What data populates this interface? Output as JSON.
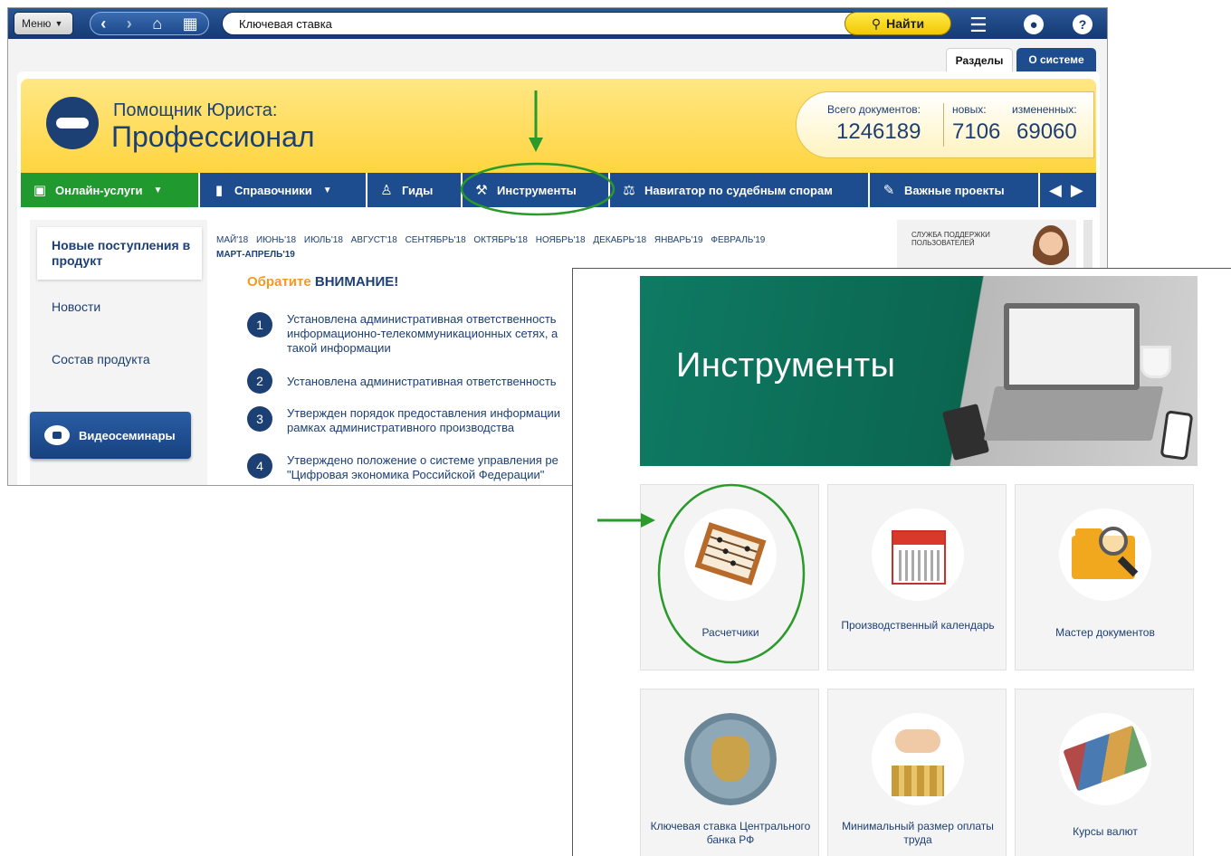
{
  "topbar": {
    "menu_label": "Меню",
    "search_value": "Ключевая ставка",
    "find_label": "Найти"
  },
  "tabs": {
    "sections": "Разделы",
    "about": "О системе"
  },
  "logo": {
    "line1": "Помощник Юриста:",
    "line2": "Профессионал"
  },
  "stats": {
    "total_label": "Всего документов:",
    "total_value": "1246189",
    "new_label": "новых:",
    "new_value": "7106",
    "changed_label": "измененных:",
    "changed_value": "69060"
  },
  "menubar": {
    "items": [
      {
        "label": "Онлайн-услуги"
      },
      {
        "label": "Справочники"
      },
      {
        "label": "Гиды"
      },
      {
        "label": "Инструменты"
      },
      {
        "label": "Навигатор по судебным спорам"
      },
      {
        "label": "Важные проекты"
      }
    ]
  },
  "left_panel": {
    "new_arrivals": "Новые поступления в продукт",
    "news": "Новости",
    "composition": "Состав продукта",
    "video_button": "Видеосеминары"
  },
  "months": {
    "list": "МАЙ'18 ИЮНЬ'18 ИЮЛЬ'18 АВГУСТ'18 СЕНТЯБРЬ'18 ОКТЯБРЬ'18 НОЯБРЬ'18 ДЕКАБРЬ'18 ЯНВАРЬ'19 ФЕВРАЛЬ'19",
    "last": "МАРТ-АПРЕЛЬ'19"
  },
  "notice": {
    "word1": "Обратите",
    "word2": "ВНИМАНИЕ!"
  },
  "news": [
    {
      "num": "1",
      "text": "Установлена административная ответственность информационно-телекоммуникационных сетях, а такой информации"
    },
    {
      "num": "2",
      "text": "Установлена административная ответственность"
    },
    {
      "num": "3",
      "text": "Утвержден порядок предоставления информации рамках административного производства"
    },
    {
      "num": "4",
      "text": "Утверждено положение о системе управления ре \"Цифровая экономика Российской Федерации\""
    }
  ],
  "support": {
    "label": "СЛУЖБА ПОДДЕРЖКИ ПОЛЬЗОВАТЕЛЕЙ"
  },
  "tools": {
    "title": "Инструменты",
    "tiles": [
      {
        "label": "Расчетчики"
      },
      {
        "label": "Производственный календарь"
      },
      {
        "label": "Мастер документов"
      },
      {
        "label": "Ключевая ставка Центрального банка РФ"
      },
      {
        "label": "Минимальный размер оплаты труда"
      },
      {
        "label": "Курсы валют"
      }
    ]
  },
  "colors": {
    "accent_blue": "#1d4d8f",
    "accent_green": "#209a2f",
    "annotation_green": "#2a9a2a",
    "brand_yellow": "#ffd33a"
  }
}
